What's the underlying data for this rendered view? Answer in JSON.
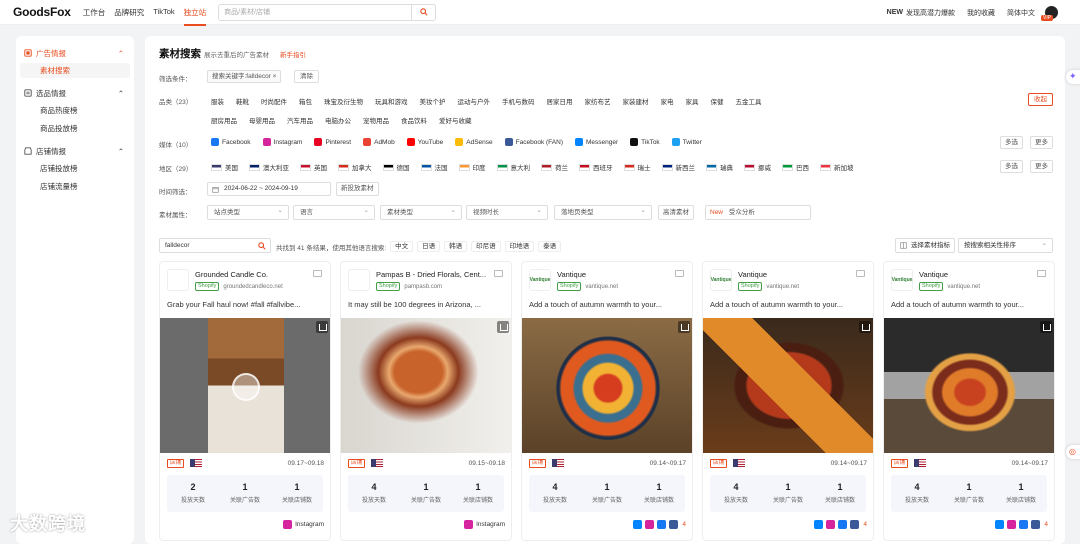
{
  "topbar": {
    "logo": "GoodsFox",
    "nav": [
      "工作台",
      "品牌研究",
      "TikTok",
      "独立站"
    ],
    "active_nav": "独立站",
    "search_placeholder": "商品/素材/店铺",
    "new_badge": "NEW",
    "promo": "发现高潜力爆款",
    "favorites": "我的收藏",
    "language": "简体中文",
    "vip": "VIP"
  },
  "sidebar": {
    "sections": [
      {
        "title": "广告情报",
        "items": [
          "素材搜索"
        ],
        "active": true
      },
      {
        "title": "选品情报",
        "items": [
          "商品热度榜",
          "商品投放榜"
        ]
      },
      {
        "title": "店铺情报",
        "items": [
          "店铺投放榜",
          "店铺流量榜"
        ]
      }
    ],
    "selected_item": "素材搜索"
  },
  "header": {
    "title": "素材搜索",
    "subtitle": "展示去重后的广告素材",
    "guide_link": "新手指引"
  },
  "filters": {
    "condition_label": "筛选条件：",
    "condition_chip": "搜索关键字:falldecor ×",
    "clear_label": "清除",
    "category_label": "品类（23）",
    "categories_row1": [
      "服装",
      "鞋靴",
      "时尚配件",
      "箱包",
      "珠宝及衍生物",
      "玩具和游戏",
      "美妆个护",
      "运动与户外",
      "手机与数码",
      "居家日用",
      "家纺布艺",
      "家装建材",
      "家电",
      "家具",
      "保健",
      "五金工具"
    ],
    "categories_row2": [
      "厨房用品",
      "母婴用品",
      "汽车用品",
      "电脑办公",
      "宠物用品",
      "食品饮料",
      "爱好与收藏"
    ],
    "collapse_label": "收起",
    "media_label": "媒体（10）",
    "media": [
      {
        "name": "Facebook",
        "color": "#1877f2"
      },
      {
        "name": "Instagram",
        "color": "#d6249f"
      },
      {
        "name": "Pinterest",
        "color": "#e60023"
      },
      {
        "name": "AdMob",
        "color": "#ea4335"
      },
      {
        "name": "YouTube",
        "color": "#ff0000"
      },
      {
        "name": "AdSense",
        "color": "#fbbc04"
      },
      {
        "name": "Facebook (FAN)",
        "color": "#3b5998"
      },
      {
        "name": "Messenger",
        "color": "#0084ff"
      },
      {
        "name": "TikTok",
        "color": "#111111"
      },
      {
        "name": "Twitter",
        "color": "#1da1f2"
      }
    ],
    "multi_select": "多选",
    "more": "更多",
    "region_label": "地区（29）",
    "regions": [
      {
        "name": "美国",
        "color": "#3c3b6e"
      },
      {
        "name": "澳大利亚",
        "color": "#012169"
      },
      {
        "name": "英国",
        "color": "#c8102e"
      },
      {
        "name": "加拿大",
        "color": "#d52b1e"
      },
      {
        "name": "德国",
        "color": "#000000"
      },
      {
        "name": "法国",
        "color": "#0055a4"
      },
      {
        "name": "印度",
        "color": "#ff9933"
      },
      {
        "name": "意大利",
        "color": "#009246"
      },
      {
        "name": "荷兰",
        "color": "#ae1c28"
      },
      {
        "name": "西班牙",
        "color": "#c60b1e"
      },
      {
        "name": "瑞士",
        "color": "#d52b1e"
      },
      {
        "name": "新西兰",
        "color": "#00247d"
      },
      {
        "name": "瑞典",
        "color": "#006aa7"
      },
      {
        "name": "挪威",
        "color": "#ba0c2f"
      },
      {
        "name": "巴西",
        "color": "#009c3b"
      },
      {
        "name": "新加坡",
        "color": "#ef3340"
      }
    ],
    "time_label": "时间筛选：",
    "date_range": "2024-06-22 ~ 2024-09-19",
    "new_ads": "新投放素材",
    "attr_label": "素材属性：",
    "dropdowns": [
      "站点类型",
      "语言",
      "素材类型",
      "视频时长",
      "落地页类型"
    ],
    "hd_label": "高清素材",
    "new_tag": "New",
    "audience": "受众分析"
  },
  "results": {
    "keyword": "falldecor",
    "found_text": "共找到 41 条结果，使用其他语言搜索:",
    "languages": [
      "中文",
      "日语",
      "韩语",
      "印尼语",
      "印地语",
      "泰语"
    ],
    "select_metric": "选择素材指标",
    "sort": "按搜索相关性排序"
  },
  "cards": [
    {
      "name": "Grounded Candle Co.",
      "platform": "Shopify",
      "domain": "groundedcandleco.net",
      "desc": "Grab your Fall haul now! #fall #fallvibe...",
      "tag": "店铺",
      "date": "09.17~09.18",
      "days": "2",
      "ads": "1",
      "shops": "1",
      "days_label": "投放天数",
      "ads_label": "关联广告数",
      "shops_label": "关联店铺数",
      "media": "Instagram",
      "extra": "",
      "logo": ""
    },
    {
      "name": "Pampas B - Dried Florals, Cent...",
      "platform": "Shopify",
      "domain": "pampasb.com",
      "desc": "It may still be 100 degrees in Arizona, ...",
      "tag": "店铺",
      "date": "09.15~09.18",
      "days": "4",
      "ads": "1",
      "shops": "1",
      "days_label": "投放天数",
      "ads_label": "关联广告数",
      "shops_label": "关联店铺数",
      "media": "Instagram",
      "extra": "",
      "logo": ""
    },
    {
      "name": "Vantique",
      "platform": "Shopify",
      "domain": "vantique.net",
      "desc": "Add a touch of autumn warmth to your...",
      "tag": "店铺",
      "date": "09.14~09.17",
      "days": "4",
      "ads": "1",
      "shops": "1",
      "days_label": "投放天数",
      "ads_label": "关联广告数",
      "shops_label": "关联店铺数",
      "media": "",
      "extra": "4",
      "logo": "Vantique"
    },
    {
      "name": "Vantique",
      "platform": "Shopify",
      "domain": "vantique.net",
      "desc": "Add a touch of autumn warmth to your...",
      "tag": "店铺",
      "date": "09.14~09.17",
      "days": "4",
      "ads": "1",
      "shops": "1",
      "days_label": "投放天数",
      "ads_label": "关联广告数",
      "shops_label": "关联店铺数",
      "media": "",
      "extra": "4",
      "logo": "Vantique"
    },
    {
      "name": "Vantique",
      "platform": "Shopify",
      "domain": "vantique.net",
      "desc": "Add a touch of autumn warmth to your...",
      "tag": "店铺",
      "date": "09.14~09.17",
      "days": "4",
      "ads": "1",
      "shops": "1",
      "days_label": "投放天数",
      "ads_label": "关联广告数",
      "shops_label": "关联店铺数",
      "media": "",
      "extra": "4",
      "logo": "Vantique"
    }
  ],
  "colors": {
    "accent": "#e84c1f"
  },
  "watermark": "大数跨境"
}
